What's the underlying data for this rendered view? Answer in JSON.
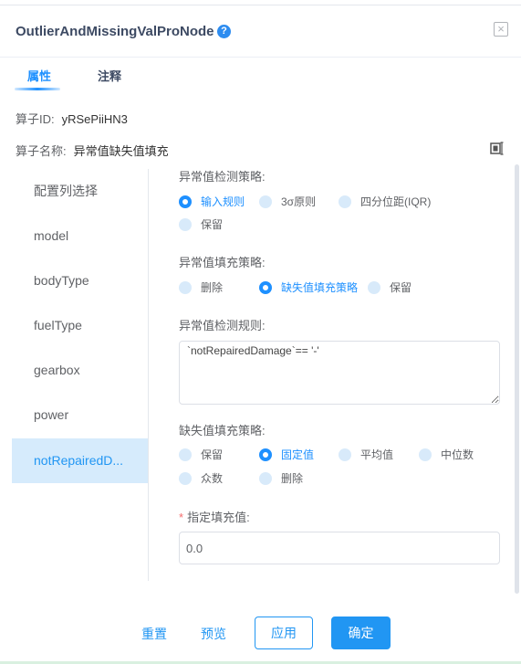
{
  "header": {
    "title": "OutlierAndMissingValProNode",
    "help_icon": "question-circle-icon",
    "close_icon": "close-icon"
  },
  "tabs": [
    {
      "label": "属性",
      "active": true
    },
    {
      "label": "注释",
      "active": false
    }
  ],
  "meta": {
    "id_label": "算子ID:",
    "id_value": "yRSePiiHN3",
    "name_label": "算子名称:",
    "name_value": "异常值缺失值填充"
  },
  "columns": [
    "配置列选择",
    "model",
    "bodyType",
    "fuelType",
    "gearbox",
    "power",
    "notRepairedD..."
  ],
  "selected_column": "notRepairedD...",
  "form": {
    "outlier_detect_label": "异常值检测策略:",
    "outlier_detect_options": [
      "输入规则",
      "3σ原则",
      "四分位距(IQR)",
      "保留"
    ],
    "outlier_detect_selected": "输入规则",
    "outlier_fill_label": "异常值填充策略:",
    "outlier_fill_options": [
      "删除",
      "缺失值填充策略",
      "保留"
    ],
    "outlier_fill_selected": "缺失值填充策略",
    "rule_label": "异常值检测规则:",
    "rule_value": "`notRepairedDamage`== '-'",
    "missing_fill_label": "缺失值填充策略:",
    "missing_fill_options": [
      "保留",
      "固定值",
      "平均值",
      "中位数",
      "众数",
      "删除"
    ],
    "missing_fill_selected": "固定值",
    "fill_value_required": "*",
    "fill_value_label": "指定填充值:",
    "fill_value": "0.0"
  },
  "footer": {
    "reset": "重置",
    "preview": "预览",
    "apply": "应用",
    "confirm": "确定"
  },
  "colors": {
    "accent": "#2196f3",
    "selected_bg": "#d6ebfc",
    "title": "#3d4a63"
  }
}
